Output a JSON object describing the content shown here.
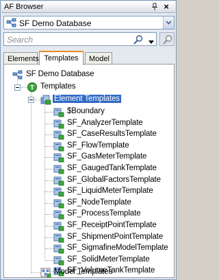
{
  "titlebar": {
    "title": "AF Browser",
    "pin_icon": "pin-icon",
    "close_label": "×"
  },
  "database": {
    "name": "SF Demo Database"
  },
  "search": {
    "placeholder": "Search"
  },
  "tabs": [
    {
      "label": "Elements",
      "active": false
    },
    {
      "label": "Templates",
      "active": true
    },
    {
      "label": "Model",
      "active": false
    }
  ],
  "tree": {
    "root": "SF Demo Database",
    "templates": "Templates",
    "element_templates": "Element Templates",
    "items": [
      "$Boundary",
      "SF_AnalyzerTemplate",
      "SF_CaseResultsTemplate",
      "SF_FlowTemplate",
      "SF_GasMeterTemplate",
      "SF_GaugedTankTemplate",
      "SF_GlobalFactorsTemplate",
      "SF_LiquidMeterTemplate",
      "SF_NodeTemplate",
      "SF_ProcessTemplate",
      "SF_ReceiptPointTemplate",
      "SF_ShipmentPointTemplate",
      "SF_SigmafineModelTemplate",
      "SF_SolidMeterTemplate",
      "SF_VolumeTankTemplate"
    ],
    "model_templates": "Model Templates"
  },
  "colors": {
    "selection": "#316ac5",
    "active_tab_accent": "#e68b2c",
    "border": "#7f9db9"
  }
}
